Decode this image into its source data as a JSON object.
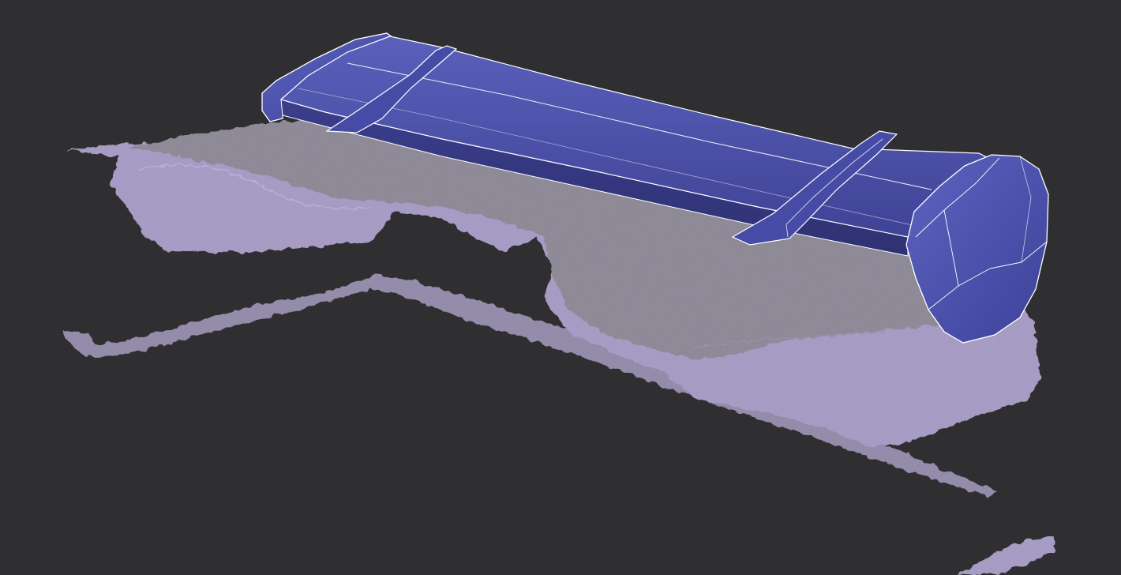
{
  "viewport": {
    "background_color": "#2f2f31"
  },
  "scene": {
    "objects": [
      {
        "name": "rear-spoiler-model",
        "type": "cad-surface",
        "color": "#4a4fa8",
        "edge_color": "#ffffff"
      },
      {
        "name": "scan-point-cloud",
        "type": "3d-scan-mesh",
        "top_color": "#85818c",
        "side_color": "#a99ccc"
      }
    ]
  }
}
